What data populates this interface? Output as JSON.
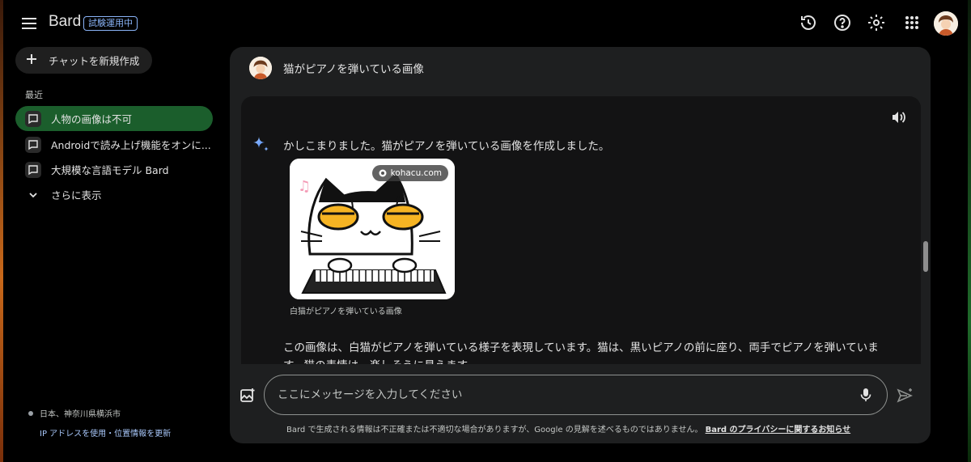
{
  "app": {
    "brand": "Bard",
    "badge": "試験運用中"
  },
  "sidebar": {
    "new_chat_label": "チャットを新規作成",
    "recent_label": "最近",
    "items": [
      {
        "label": "人物の画像は不可",
        "active": true
      },
      {
        "label": "Androidで読み上げ機能をオンに...",
        "active": false
      },
      {
        "label": "大規模な言語モデル Bard",
        "active": false
      }
    ],
    "show_more_label": "さらに表示",
    "location_text": "日本、神奈川県横浜市",
    "location_link": "IP アドレスを使用・位置情報を更新"
  },
  "conversation": {
    "user_prompt": "猫がピアノを弾いている画像",
    "response_intro": "かしこまりました。猫がピアノを弾いている画像を作成しました。",
    "image_source": "kohacu.com",
    "image_caption": "白猫がピアノを弾いている画像",
    "response_paragraph": "この画像は、白猫がピアノを弾いている様子を表現しています。猫は、黒いピアノの前に座り、両手でピアノを弾いています。猫の表情は、楽しそうに見えます。"
  },
  "input": {
    "placeholder": "ここにメッセージを入力してください"
  },
  "footer": {
    "disclaimer": "Bard で生成される情報は不正確または不適切な場合がありますが、Google の見解を述べるものではありません。",
    "privacy_link": "Bard のプライバシーに関するお知らせ"
  },
  "colors": {
    "active_item": "#1b5e2c",
    "accent_link": "#a8c7fa",
    "badge": "#8ab4f8"
  }
}
